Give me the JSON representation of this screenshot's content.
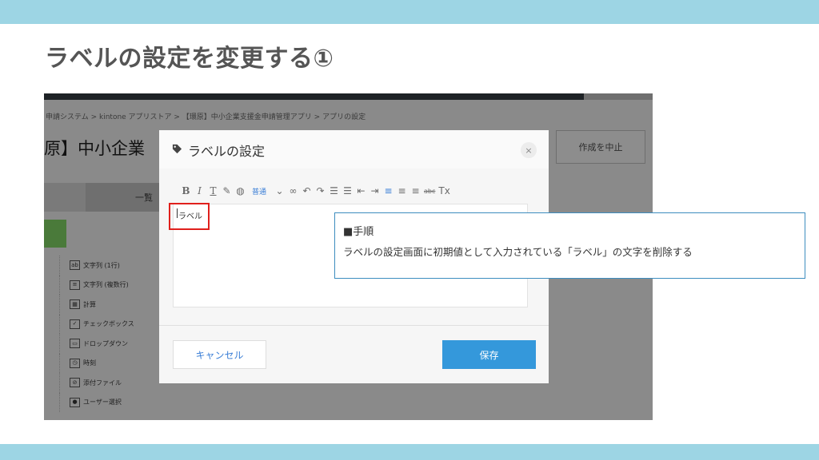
{
  "slide": {
    "title": "ラベルの設定を変更する①",
    "colors": {
      "band": "#9dd5e4",
      "title": "#555555",
      "callout_border": "#3d8dbf",
      "highlight": "#e0201c"
    }
  },
  "background_app": {
    "breadcrumb": "申請システム  >  kintone アプリストア  >  【環原】中小企業支援金申請管理アプリ  >  アプリの設定",
    "app_title": "原】中小企業",
    "stop_button": "作成を中止",
    "tab_label": "一覧",
    "palette": [
      {
        "icon": "text-single-icon",
        "glyph": "ab",
        "label": "文字列 (1行)"
      },
      {
        "icon": "text-multi-icon",
        "glyph": "≡",
        "label": "文字列 (複数行)"
      },
      {
        "icon": "calc-icon",
        "glyph": "▦",
        "label": "計算"
      },
      {
        "icon": "checkbox-icon",
        "glyph": "✓",
        "label": "チェックボックス"
      },
      {
        "icon": "dropdown-icon",
        "glyph": "▭",
        "label": "ドロップダウン"
      },
      {
        "icon": "time-icon",
        "glyph": "◷",
        "label": "時刻"
      },
      {
        "icon": "attachment-icon",
        "glyph": "⊘",
        "label": "添付ファイル"
      },
      {
        "icon": "user-select-icon",
        "glyph": "●",
        "label": "ユーザー選択"
      }
    ]
  },
  "dialog": {
    "title": "ラベルの設定",
    "close_glyph": "×",
    "toolbar": {
      "font_size": "普通"
    },
    "editor_text": "ラベル",
    "cancel_label": "キャンセル",
    "save_label": "保存"
  },
  "callout": {
    "heading": "■手順",
    "body": "ラベルの設定画面に初期値として入力されている「ラベル」の文字を削除する"
  }
}
